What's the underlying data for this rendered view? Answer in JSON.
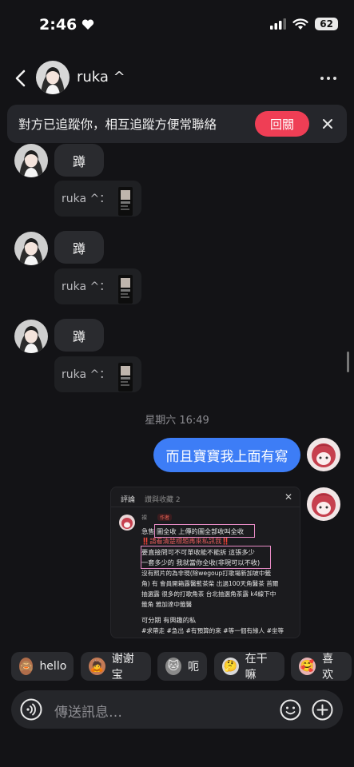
{
  "status_bar": {
    "time": "2:46",
    "battery": "62"
  },
  "header": {
    "contact_name": "ruka ^"
  },
  "banner": {
    "text": "對方已追蹤你，相互追蹤方便常聯絡",
    "follow_label": "回關"
  },
  "messages_in": [
    {
      "text": "蹲",
      "reply_label": "ruka ^："
    },
    {
      "text": "蹲",
      "reply_label": "ruka ^："
    },
    {
      "text": "蹲",
      "reply_label": "ruka ^："
    }
  ],
  "timestamp": "星期六 16:49",
  "message_out": {
    "text": "而且寶寶我上面有寫"
  },
  "shared_screenshot": {
    "tab_active": "評論",
    "tab_other": "讚與收藏 2",
    "user": "裸",
    "author_badge": "作者",
    "lines": [
      "急售 圖全收 上傳的圖全部收叫全收",
      "‼️請看清楚標題再來私訊我‼️",
      "要直接問可不可單收能不能拆 這張多少",
      "一套多少的 我就當你全收(非現可以不收)",
      "沒有照片的為非現(除wegoup打歌場新加坡中籤",
      "角) 有 會員開箱露醫藍茶柴 出過100天角醫茶 首爾",
      "抽選露 很多的打歌角茶 台北抽選角茶露 k4線下中",
      "籤角 雅加達中籤醫",
      "可分期 有興趣的私",
      "#求帶走 #急出 #有預算的來 #等一個有緣人 #坐等"
    ]
  },
  "quick_replies": [
    {
      "label": "hello",
      "icon": "monkey-emoji-icon"
    },
    {
      "label": "谢谢宝",
      "icon": "bow-emoji-icon"
    },
    {
      "label": "呃",
      "icon": "cat-emoji-icon"
    },
    {
      "label": "在干嘛",
      "icon": "thinking-emoji-icon"
    },
    {
      "label": "喜欢",
      "icon": "heart-emoji-icon"
    }
  ],
  "composer": {
    "placeholder": "傳送訊息…"
  },
  "colors": {
    "background": "#131316",
    "bubble_in": "#2a2b2f",
    "bubble_out": "#3d7df6",
    "follow_button": "#ef3e55"
  }
}
